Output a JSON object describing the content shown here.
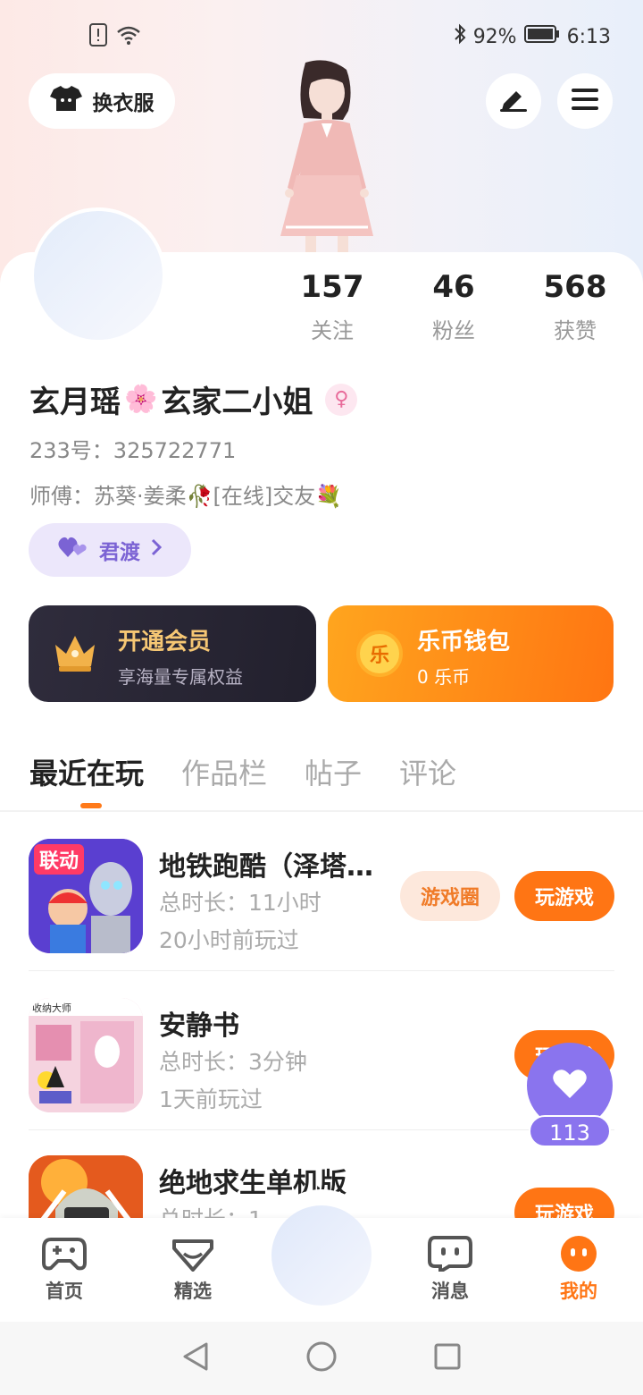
{
  "status_bar": {
    "battery": "92%",
    "time": "6:13"
  },
  "header": {
    "outfit_label": "换衣服"
  },
  "profile": {
    "stats": [
      {
        "value": "157",
        "label": "关注"
      },
      {
        "value": "46",
        "label": "粉丝"
      },
      {
        "value": "568",
        "label": "获赞"
      }
    ],
    "name_part1": "玄月瑶",
    "name_flower": "🌸",
    "name_part2": "玄家二小姐",
    "gender_symbol": "♀",
    "id_line": "233号：325722771",
    "master_line": "师傅：苏葵·姜柔🥀[在线]交友💐",
    "couple_label": "君渡"
  },
  "features": {
    "vip_title": "开通会员",
    "vip_sub": "享海量专属权益",
    "wallet_title": "乐币钱包",
    "wallet_sub": "0 乐币",
    "wallet_coin": "乐",
    "vip_title_color": "#f6c774",
    "vip_sub_color": "#b7b2c4"
  },
  "tabs": [
    "最近在玩",
    "作品栏",
    "帖子",
    "评论"
  ],
  "games": [
    {
      "name": "地铁跑酷（泽塔奥特曼联动）",
      "duration": "总时长：11小时",
      "last": "20小时前玩过",
      "circle_btn": "游戏圈",
      "play_btn": "玩游戏",
      "icon_text": "联动"
    },
    {
      "name": "安静书",
      "duration": "总时长：3分钟",
      "last": "1天前玩过",
      "play_btn": "玩游戏",
      "icon_text": "收纳大师"
    },
    {
      "name": "绝地求生单机版",
      "duration": "总时长：1",
      "play_btn": "玩游戏"
    }
  ],
  "like_float": {
    "count": "113"
  },
  "bottom_nav": [
    {
      "label": "首页"
    },
    {
      "label": "精选"
    },
    {
      "label": "消息"
    },
    {
      "label": "我的"
    }
  ],
  "colors": {
    "accent": "#ff7514",
    "purple": "#8a74ee"
  }
}
